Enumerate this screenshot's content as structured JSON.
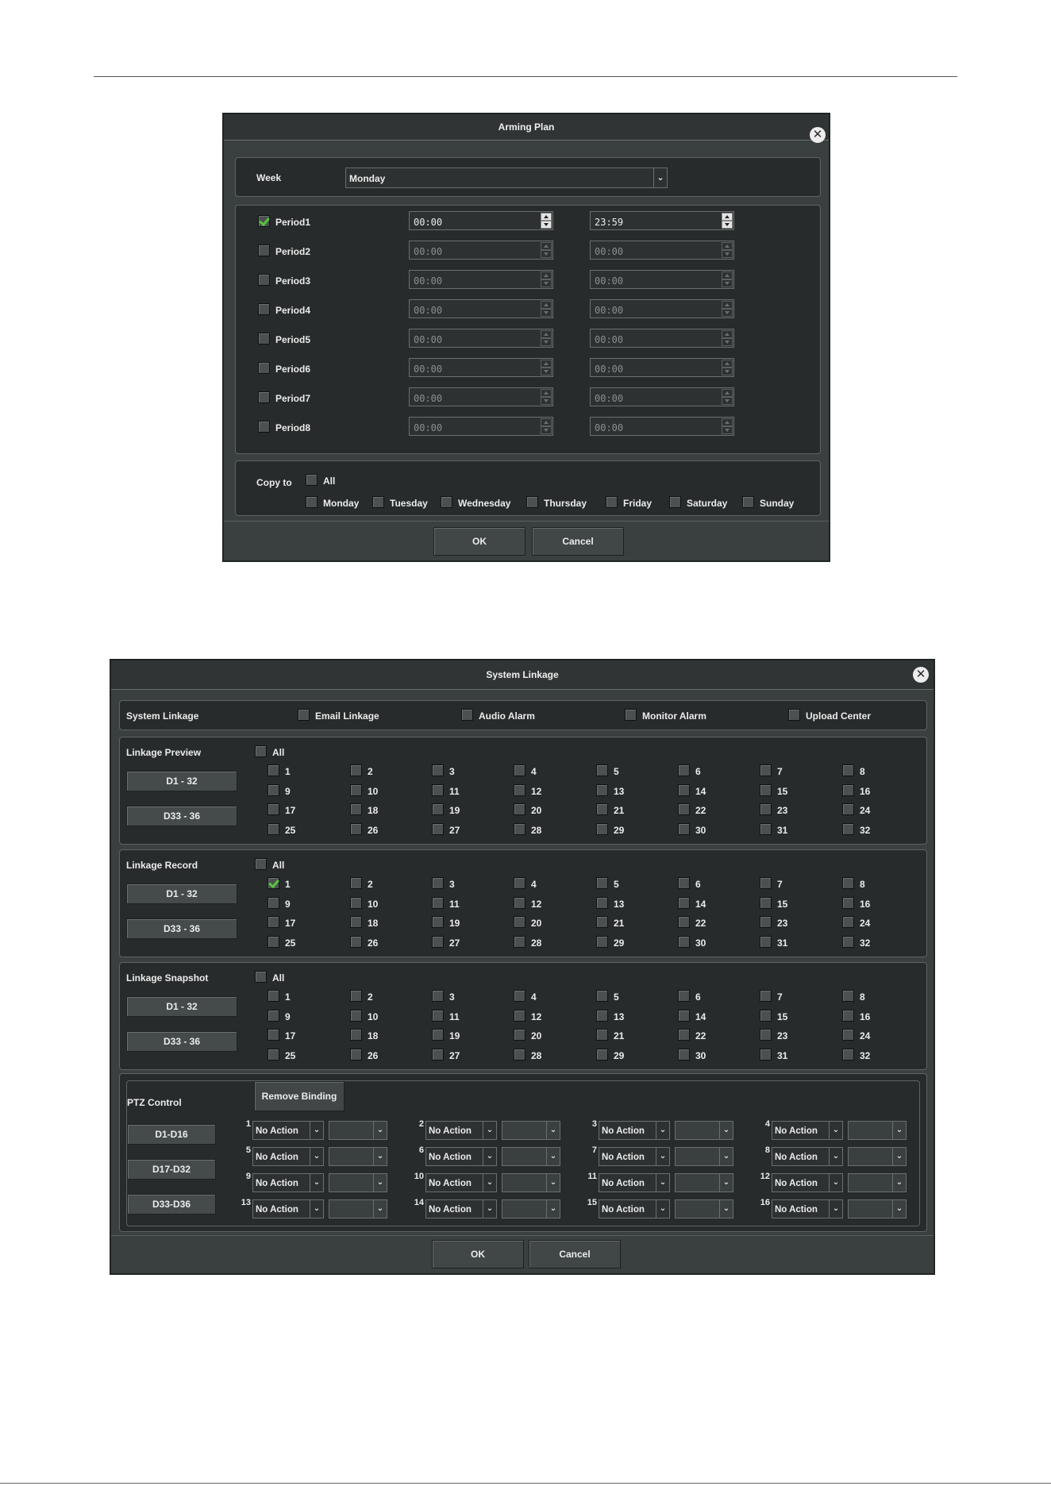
{
  "arming_plan": {
    "title": "Arming Plan",
    "week_label": "Week",
    "week_value": "Monday",
    "periods": [
      {
        "label": "Period1",
        "checked": true,
        "start": "00:00",
        "end": "23:59"
      },
      {
        "label": "Period2",
        "checked": false,
        "start": "00:00",
        "end": "00:00"
      },
      {
        "label": "Period3",
        "checked": false,
        "start": "00:00",
        "end": "00:00"
      },
      {
        "label": "Period4",
        "checked": false,
        "start": "00:00",
        "end": "00:00"
      },
      {
        "label": "Period5",
        "checked": false,
        "start": "00:00",
        "end": "00:00"
      },
      {
        "label": "Period6",
        "checked": false,
        "start": "00:00",
        "end": "00:00"
      },
      {
        "label": "Period7",
        "checked": false,
        "start": "00:00",
        "end": "00:00"
      },
      {
        "label": "Period8",
        "checked": false,
        "start": "00:00",
        "end": "00:00"
      }
    ],
    "copy_to_label": "Copy to",
    "all_label": "All",
    "days": [
      "Monday",
      "Tuesday",
      "Wednesday",
      "Thursday",
      "Friday",
      "Saturday",
      "Sunday"
    ],
    "ok_label": "OK",
    "cancel_label": "Cancel"
  },
  "system_linkage": {
    "title": "System Linkage",
    "row_label": "System Linkage",
    "options": [
      "Email Linkage",
      "Audio Alarm",
      "Monitor Alarm",
      "Upload Center"
    ],
    "all_label": "All",
    "sections": [
      {
        "title": "Linkage Preview",
        "checked": []
      },
      {
        "title": "Linkage Record",
        "checked": [
          1
        ]
      },
      {
        "title": "Linkage Snapshot",
        "checked": []
      }
    ],
    "group_buttons": [
      "D1 - 32",
      "D33 - 36"
    ],
    "ptz": {
      "title": "PTZ Control",
      "remove_binding": "Remove Binding",
      "groups": [
        "D1-D16",
        "D17-D32",
        "D33-D36"
      ],
      "action_value": "No Action",
      "count": 16
    },
    "ok_label": "OK",
    "cancel_label": "Cancel"
  }
}
